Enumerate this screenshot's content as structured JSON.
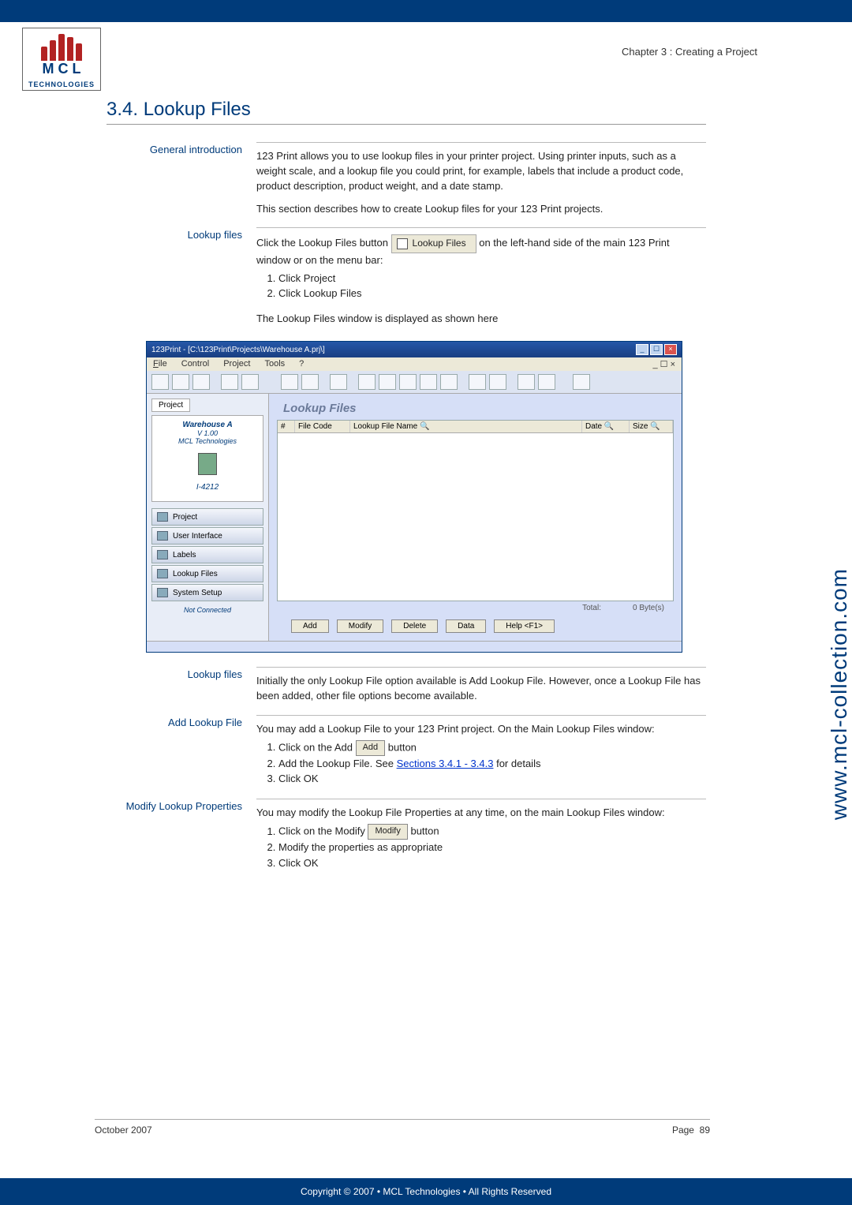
{
  "chapter": "Chapter 3 : Creating a Project",
  "heading": "3.4. Lookup Files",
  "sections": {
    "general": {
      "label": "General introduction",
      "p1": "123 Print allows you to use lookup files in your printer project. Using printer inputs, such as a weight scale, and a lookup file you could print, for example, labels that include a product code, product description, product weight, and a date stamp.",
      "p2": "This section describes how to create Lookup files for your 123 Print projects."
    },
    "lookup1": {
      "label": "Lookup files",
      "lead_a": "Click the Lookup Files button ",
      "btn": "Lookup Files",
      "lead_b": " on the left-hand side of the main 123 Print window or on the menu bar:",
      "li1": "Click Project",
      "li2": "Click Lookup Files",
      "after": "The Lookup Files window is displayed as shown here"
    },
    "screenshot": {
      "title": "123Print - [C:\\123Print\\Projects\\Warehouse A.prj\\]",
      "menu": {
        "file": "File",
        "control": "Control",
        "project": "Project",
        "tools": "Tools",
        "help": "?"
      },
      "mdi_ctrl": "_ ☐ ×",
      "left": {
        "tab": "Project",
        "name": "Warehouse A",
        "ver": "V 1.00",
        "co": "MCL Technologies",
        "model": "I-4212",
        "nav": [
          "Project",
          "User Interface",
          "Labels",
          "Lookup Files",
          "System Setup"
        ],
        "status": "Not Connected"
      },
      "right": {
        "title": "Lookup Files",
        "cols": {
          "n": "#",
          "code": "File Code",
          "name": "Lookup File Name",
          "date": "Date",
          "size": "Size"
        },
        "total_l": "Total:",
        "total_v": "0 Byte(s)",
        "btns": [
          "Add",
          "Modify",
          "Delete",
          "Data",
          "Help <F1>"
        ]
      }
    },
    "lookup2": {
      "label": "Lookup files",
      "p": "Initially the only Lookup File option available is Add Lookup File. However, once a Lookup File has been added, other file options become available."
    },
    "add": {
      "label": "Add Lookup File",
      "p": "You may add a Lookup File to your 123 Print project. On the Main Lookup Files window:",
      "li1a": "Click on the Add ",
      "li1btn": "Add",
      "li1b": " button",
      "li2a": "Add the Lookup File. See ",
      "li2link": "Sections 3.4.1 - 3.4.3",
      "li2b": " for details",
      "li3": "Click OK"
    },
    "modify": {
      "label": "Modify Lookup Properties",
      "p": "You may modify the Lookup File Properties at any time, on the main Lookup Files window:",
      "li1a": "Click on the Modify ",
      "li1btn": "Modify",
      "li1b": " button",
      "li2": "Modify the properties as appropriate",
      "li3": "Click OK"
    }
  },
  "footer": {
    "date": "October 2007",
    "page_l": "Page",
    "page_n": "89"
  },
  "side_url": "www.mcl-collection.com",
  "copyright": "Copyright © 2007 • MCL Technologies • All Rights Reserved"
}
